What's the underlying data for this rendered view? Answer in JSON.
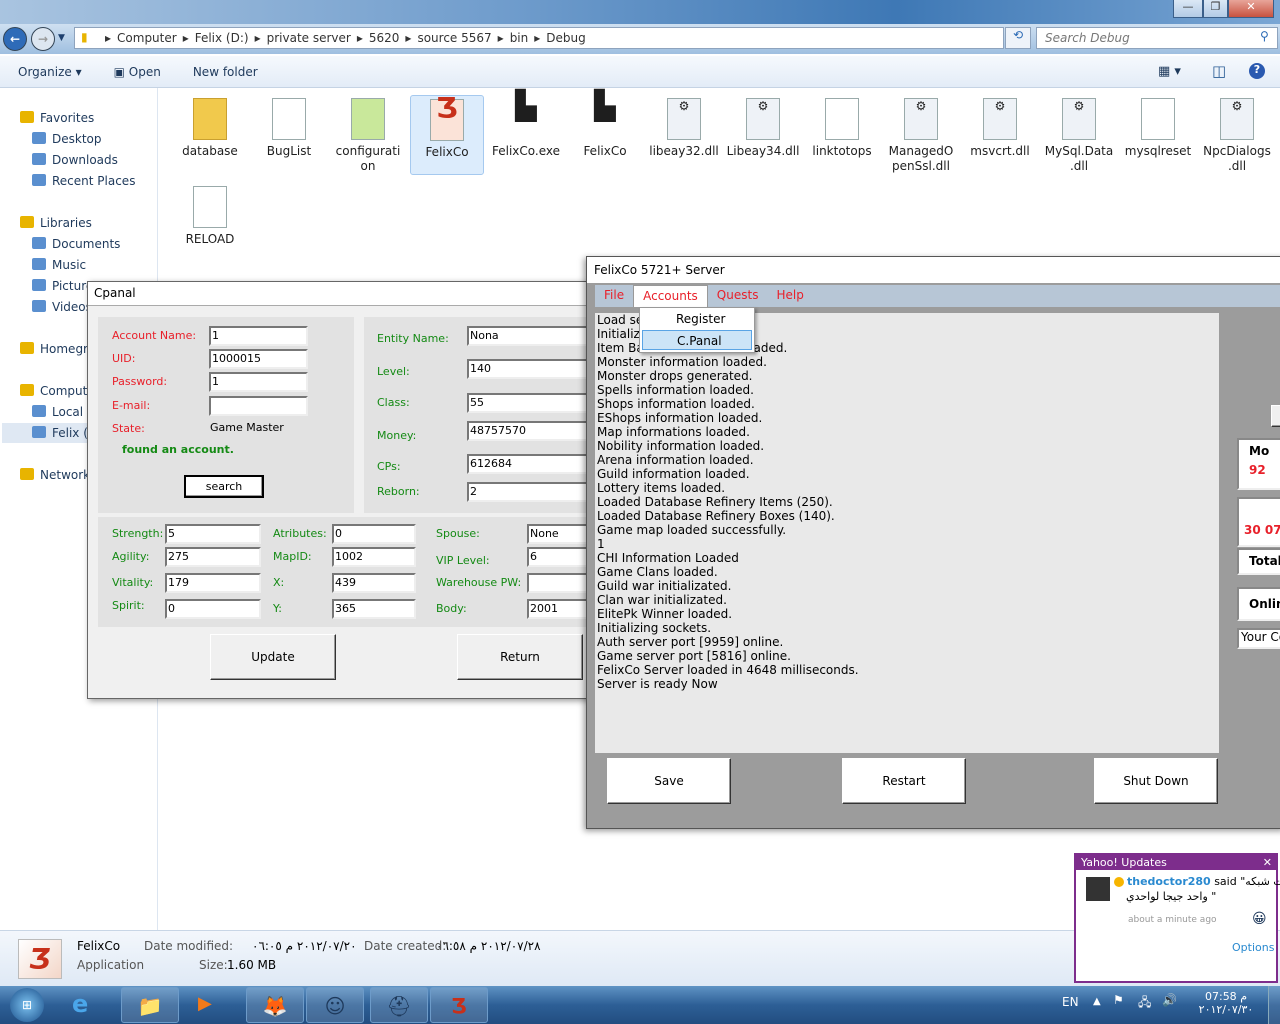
{
  "explorer": {
    "breadcrumb": [
      "Computer",
      "Felix (D:)",
      "private server",
      "5620",
      "source 5567",
      "bin",
      "Debug"
    ],
    "search_placeholder": "Search Debug",
    "toolbar": {
      "organize": "Organize ▾",
      "open": "Open",
      "new_folder": "New folder"
    },
    "nav": [
      {
        "label": "Favorites",
        "icon": "star-icon",
        "indent": 0
      },
      {
        "label": "Desktop",
        "icon": "desktop-icon",
        "indent": 1
      },
      {
        "label": "Downloads",
        "icon": "downloads-icon",
        "indent": 1
      },
      {
        "label": "Recent Places",
        "icon": "recent-places-icon",
        "indent": 1
      },
      {
        "label": "Libraries",
        "icon": "library-icon",
        "indent": 0
      },
      {
        "label": "Documents",
        "icon": "documents-icon",
        "indent": 1
      },
      {
        "label": "Music",
        "icon": "music-icon",
        "indent": 1
      },
      {
        "label": "Pictures",
        "icon": "pictures-icon",
        "indent": 1
      },
      {
        "label": "Videos",
        "icon": "videos-icon",
        "indent": 1
      },
      {
        "label": "Homegr",
        "icon": "homegroup-icon",
        "indent": 0
      },
      {
        "label": "Comput",
        "icon": "computer-icon",
        "indent": 0
      },
      {
        "label": "Local D",
        "icon": "drive-icon",
        "indent": 1
      },
      {
        "label": "Felix (D",
        "icon": "drive-icon",
        "indent": 1
      },
      {
        "label": "Network",
        "icon": "network-icon",
        "indent": 0
      }
    ],
    "files": [
      {
        "name": "database",
        "kind": "folder"
      },
      {
        "name": "BugList",
        "kind": "text"
      },
      {
        "name": "configurati on",
        "kind": "config"
      },
      {
        "name": "FelixCo",
        "kind": "app",
        "selected": true
      },
      {
        "name": "FelixCo.exe",
        "kind": "exe"
      },
      {
        "name": "FelixCo",
        "kind": "exe"
      },
      {
        "name": "libeay32.dll",
        "kind": "dll"
      },
      {
        "name": "Libeay34.dll",
        "kind": "dll"
      },
      {
        "name": "linktotops",
        "kind": "file"
      },
      {
        "name": "ManagedO penSsl.dll",
        "kind": "dll"
      },
      {
        "name": "msvcrt.dll",
        "kind": "dll"
      },
      {
        "name": "MySql.Data .dll",
        "kind": "dll"
      },
      {
        "name": "mysqlreset",
        "kind": "text"
      },
      {
        "name": "NpcDialogs .dll",
        "kind": "dll"
      },
      {
        "name": "RELOAD",
        "kind": "text"
      }
    ],
    "details": {
      "name": "FelixCo",
      "type": "Application",
      "modified_label": "Date modified:",
      "modified": "٢٠١٢/٠٧/٢٠ م ٠٦:٠٥",
      "created_label": "Date created:",
      "created": "٢٠١٢/٠٧/٢٨ م ٠٦:٥٨",
      "size_label": "Size:",
      "size": "1.60 MB"
    }
  },
  "cpanal": {
    "title": "Cpanal",
    "account": [
      {
        "label": "Account Name:",
        "value": "1"
      },
      {
        "label": "UID:",
        "value": "1000015"
      },
      {
        "label": "Password:",
        "value": "1"
      },
      {
        "label": "E-mail:",
        "value": ""
      }
    ],
    "state_label": "State:",
    "state": "Game Master",
    "status": "found an account.",
    "search": "search",
    "entity": [
      {
        "label": "Entity Name:",
        "value": "Nona"
      },
      {
        "label": "Level:",
        "value": "140"
      },
      {
        "label": "Class:",
        "value": "55"
      },
      {
        "label": "Money:",
        "value": "48757570"
      },
      {
        "label": "CPs:",
        "value": "612684"
      },
      {
        "label": "Reborn:",
        "value": "2"
      }
    ],
    "stats": [
      [
        {
          "label": "Strength:",
          "value": "5"
        },
        {
          "label": "Agility:",
          "value": "275"
        },
        {
          "label": "Vitality:",
          "value": "179"
        },
        {
          "label": "Spirit:",
          "value": "0"
        }
      ],
      [
        {
          "label": "Atributes:",
          "value": "0"
        },
        {
          "label": "MapID:",
          "value": "1002"
        },
        {
          "label": "X:",
          "value": "439"
        },
        {
          "label": "Y:",
          "value": "365"
        }
      ],
      [
        {
          "label": "Spouse:",
          "value": "None"
        },
        {
          "label": "VIP Level:",
          "value": "6"
        },
        {
          "label": "Warehouse PW:",
          "value": ""
        },
        {
          "label": "Body:",
          "value": "2001"
        }
      ]
    ],
    "update": "Update",
    "return": "Return"
  },
  "server": {
    "title": "FelixCo 5721+ Server",
    "menu": [
      "File",
      "Accounts",
      "Quests",
      "Help"
    ],
    "dropdown": [
      "Register",
      "C.Panal"
    ],
    "log": [
      "Load se",
      "Initializin",
      "Item Ba                       n loaded.",
      "Monster information loaded.",
      "Monster drops generated.",
      "Spells information loaded.",
      "Shops information loaded.",
      "EShops information loaded.",
      "Map informations loaded.",
      "Nobility information loaded.",
      "Arena information loaded.",
      "Guild information loaded.",
      "Lottery items loaded.",
      "Loaded Database Refinery Items (250).",
      "Loaded Database Refinery Boxes (140).",
      "Game map loaded successfully.",
      "1",
      "CHI Information Loaded",
      "Game Clans loaded.",
      "Guild war initializated.",
      "Clan war initializated.",
      "ElitePk Winner loaded.",
      "Initializing sockets.",
      "Auth server port [9959] online.",
      "Game server port [5816] online.",
      "FelixCo Server loaded in 4648 milliseconds.",
      "Server is ready Now"
    ],
    "buttons": {
      "save": "Save",
      "restart": "Restart",
      "shutdown": "Shut Down"
    },
    "side": {
      "box1_title": "Mo",
      "box1_value": "92",
      "box2_value": "30 07",
      "total": "Total",
      "online": "Online",
      "input": "Your Co"
    }
  },
  "yahoo": {
    "title": "Yahoo! Updates",
    "user": "thedoctor280",
    "said": "said",
    "msg": "\"جبت شبكه",
    "msg2": "واحد جيجا لواحدي \"",
    "time": "about a minute ago",
    "options": "Options"
  },
  "tray": {
    "lang": "EN",
    "time": "07:58 م",
    "date": "٢٠١٢/٠٧/٣٠"
  },
  "colors": {
    "label_red": "#e8202a",
    "label_green": "#148a14",
    "yahoo_purple": "#7d2d8c"
  }
}
